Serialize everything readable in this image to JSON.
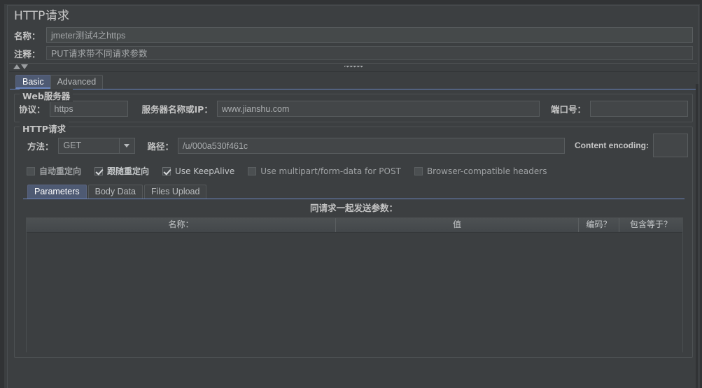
{
  "window": {
    "title": "HTTP请求"
  },
  "header": {
    "name_label": "名称：",
    "name_value": "jmeter测试4之https",
    "comment_label": "注释：",
    "comment_value": "PUT请求带不同请求参数"
  },
  "splitter": {
    "up_icon": "triangle-up-icon",
    "down_icon": "triangle-down-icon",
    "grip_icon": "splitter-grip-icon"
  },
  "main_tabs": [
    {
      "label": "Basic",
      "selected": true
    },
    {
      "label": "Advanced",
      "selected": false
    }
  ],
  "web_server": {
    "group_title": "Web服务器",
    "protocol_label": "协议：",
    "protocol_value": "https",
    "server_label": "服务器名称或IP：",
    "server_value": "www.jianshu.com",
    "port_label": "端口号：",
    "port_value": ""
  },
  "http_request": {
    "group_title": "HTTP请求",
    "method_label": "方法：",
    "method_value": "GET",
    "method_dropdown_icon": "chevron-down-icon",
    "path_label": "路径：",
    "path_value": "/u/000a530f461c",
    "content_encoding_label": "Content encoding:",
    "content_encoding_value": "",
    "checkboxes": [
      {
        "label": "自动重定向",
        "checked": false,
        "lang": "cn"
      },
      {
        "label": "跟随重定向",
        "checked": true,
        "lang": "cn"
      },
      {
        "label": "Use KeepAlive",
        "checked": true,
        "lang": "en"
      },
      {
        "label": "Use multipart/form-data for POST",
        "checked": false,
        "lang": "en"
      },
      {
        "label": "Browser-compatible headers",
        "checked": false,
        "lang": "en"
      }
    ]
  },
  "sub_tabs": [
    {
      "label": "Parameters",
      "selected": true
    },
    {
      "label": "Body Data",
      "selected": false
    },
    {
      "label": "Files Upload",
      "selected": false
    }
  ],
  "parameters": {
    "caption": "同请求一起发送参数：",
    "columns": [
      "名称：",
      "值",
      "编码？",
      "包含等于？"
    ],
    "rows": []
  },
  "colors": {
    "background": "#3c3f41",
    "panel_border": "#4a4e51",
    "tab_selected_bg": "#4e5a73",
    "tab_accent": "#6b86c0",
    "input_bg": "#434648",
    "text": "#bbbbbb"
  }
}
